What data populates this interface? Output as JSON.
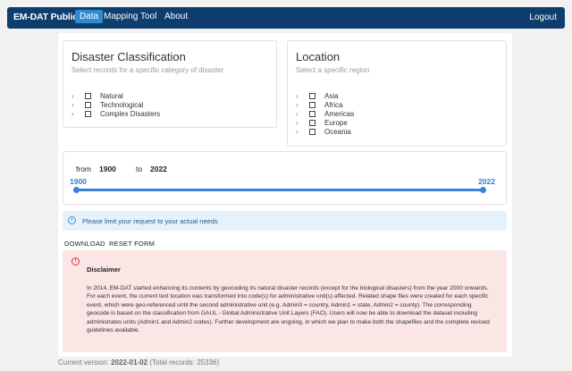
{
  "navbar": {
    "brand": "EM-DAT Public",
    "items": [
      {
        "label": "Data",
        "active": true
      },
      {
        "label": "Mapping Tool",
        "active": false
      },
      {
        "label": "About",
        "active": false
      }
    ],
    "logout": "Logout",
    "bg_color": "#0e3e6d",
    "active_color": "#2f8ad0"
  },
  "classification": {
    "title": "Disaster Classification",
    "subtitle": "Select records for a specific category of disaster",
    "items": [
      "Natural",
      "Technological",
      "Complex Disasters"
    ]
  },
  "location": {
    "title": "Location",
    "subtitle": "Select a specific region",
    "items": [
      "Asia",
      "Africa",
      "Americas",
      "Europe",
      "Oceania"
    ]
  },
  "year_range": {
    "from_label": "from",
    "from_value": "1900",
    "to_label": "to",
    "to_value": "2022",
    "min_label": "1900",
    "max_label": "2022",
    "accent_color": "#3b82d6"
  },
  "info": {
    "icon": "info-icon",
    "text": "Please limit your request to your actual needs"
  },
  "actions": {
    "download": "DOWNLOAD",
    "reset": "RESET FORM"
  },
  "disclaimer": {
    "icon": "warning-icon",
    "title": "Disclaimer",
    "body": "In 2014, EM-DAT started enhancing its contents by geocoding its natural disaster records (except for the biological disasters) from the year 2000 onwards. For each event, the current text location was transformed into code(s) for administrative unit(s) affected. Related shape files were created for each specific event, which were geo-referenced until the second administrative unit (e.g. Admin0 = country, Admin1 = state, Admin2 = county). The corresponding geocode is based on the classification from GAUL - Global Administrative Unit Layers (FAO). Users will now be able to download the dataset including administrates units (Admin1 and Admin2 codes). Further development are ongoing, in which we plan to make both the shapefiles and the complete revised guidelines available.",
    "bg_color": "#fbe5e5"
  },
  "footer": {
    "prefix": "Current version:",
    "version": "2022-01-02",
    "records": "(Total records: 25336)"
  }
}
